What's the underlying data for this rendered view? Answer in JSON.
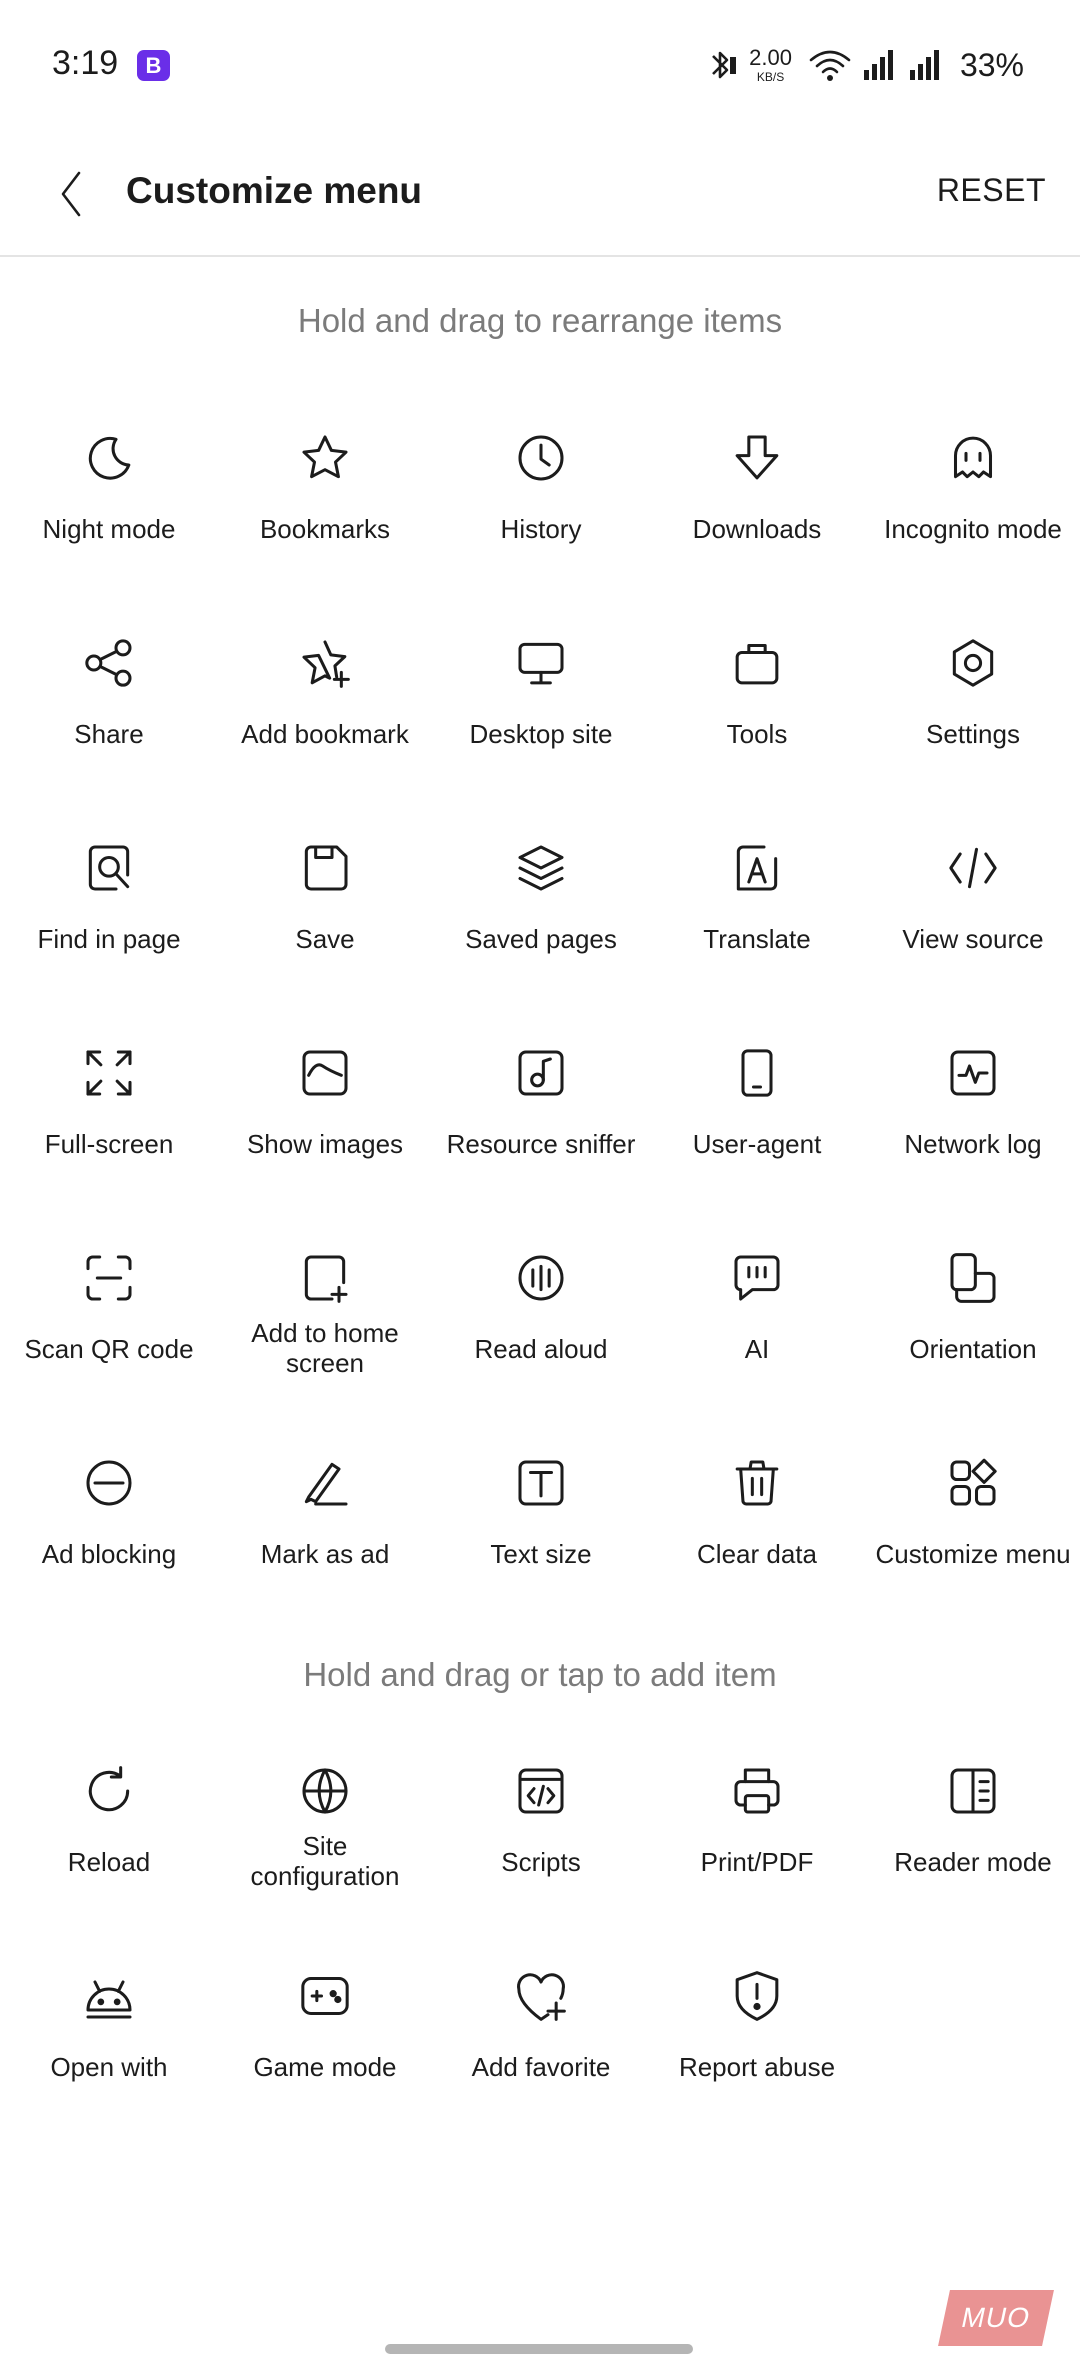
{
  "status_bar": {
    "time": "3:19",
    "app_badge": "B",
    "net_speed_value": "2.00",
    "net_speed_unit": "KB/S",
    "battery": "33%"
  },
  "toolbar": {
    "title": "Customize menu",
    "reset_label": "RESET"
  },
  "sections": {
    "current_caption": "Hold and drag to rearrange items",
    "available_caption": "Hold and drag or tap to add item"
  },
  "current_items": [
    {
      "label": "Night mode",
      "icon": "moon-icon"
    },
    {
      "label": "Bookmarks",
      "icon": "star-icon"
    },
    {
      "label": "History",
      "icon": "clock-icon"
    },
    {
      "label": "Downloads",
      "icon": "download-arrow-icon"
    },
    {
      "label": "Incognito mode",
      "icon": "ghost-icon"
    },
    {
      "label": "Share",
      "icon": "share-icon"
    },
    {
      "label": "Add bookmark",
      "icon": "star-plus-icon"
    },
    {
      "label": "Desktop site",
      "icon": "monitor-icon"
    },
    {
      "label": "Tools",
      "icon": "briefcase-icon"
    },
    {
      "label": "Settings",
      "icon": "hexagon-gear-icon"
    },
    {
      "label": "Find in page",
      "icon": "find-in-page-icon"
    },
    {
      "label": "Save",
      "icon": "floppy-icon"
    },
    {
      "label": "Saved pages",
      "icon": "layers-icon"
    },
    {
      "label": "Translate",
      "icon": "translate-icon"
    },
    {
      "label": "View source",
      "icon": "code-icon"
    },
    {
      "label": "Full-screen",
      "icon": "fullscreen-icon"
    },
    {
      "label": "Show images",
      "icon": "image-icon"
    },
    {
      "label": "Resource sniffer",
      "icon": "music-note-icon"
    },
    {
      "label": "User-agent",
      "icon": "phone-icon"
    },
    {
      "label": "Network log",
      "icon": "pulse-icon"
    },
    {
      "label": "Scan QR code",
      "icon": "scan-icon"
    },
    {
      "label": "Add to home\nscreen",
      "icon": "add-to-home-icon"
    },
    {
      "label": "Read aloud",
      "icon": "audio-wave-icon"
    },
    {
      "label": "AI",
      "icon": "chat-bubble-icon"
    },
    {
      "label": "Orientation",
      "icon": "rotate-screen-icon"
    },
    {
      "label": "Ad blocking",
      "icon": "block-icon"
    },
    {
      "label": "Mark as ad",
      "icon": "pen-icon"
    },
    {
      "label": "Text size",
      "icon": "text-size-icon"
    },
    {
      "label": "Clear data",
      "icon": "trash-icon"
    },
    {
      "label": "Customize menu",
      "icon": "grid-shapes-icon"
    }
  ],
  "available_items": [
    {
      "label": "Reload",
      "icon": "reload-icon"
    },
    {
      "label": "Site\nconfiguration",
      "icon": "globe-icon"
    },
    {
      "label": "Scripts",
      "icon": "script-window-icon"
    },
    {
      "label": "Print/PDF",
      "icon": "printer-icon"
    },
    {
      "label": "Reader mode",
      "icon": "reader-icon"
    },
    {
      "label": "Open with",
      "icon": "android-icon"
    },
    {
      "label": "Game mode",
      "icon": "gamepad-icon"
    },
    {
      "label": "Add favorite",
      "icon": "heart-plus-icon"
    },
    {
      "label": "Report abuse",
      "icon": "shield-alert-icon"
    }
  ],
  "watermark": "MUO"
}
